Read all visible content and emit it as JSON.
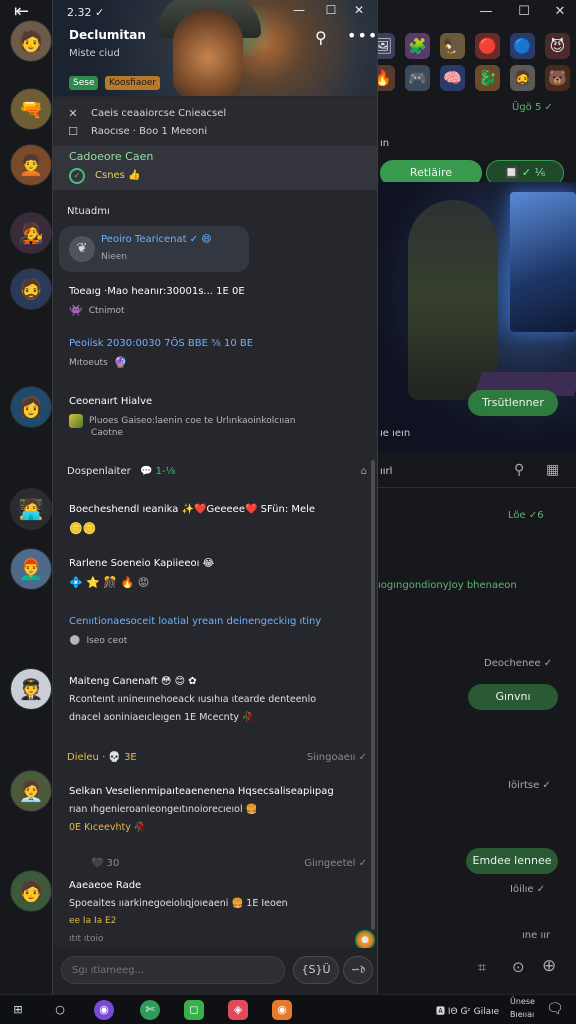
{
  "background_window": {
    "back_glyph": "⇤",
    "controls": [
      "—",
      "☐",
      "✕"
    ],
    "top_icons_row1": [
      "🖼",
      "🧩",
      "🦅",
      "🔴",
      "🔵",
      "😈"
    ],
    "top_icons_row2": [
      "🔥",
      "🎮",
      "🧠",
      "🐉",
      "🧔",
      "🐻"
    ],
    "status_top": "Ügö 5 ✓",
    "partial_label": "ın",
    "join_button": "Retläire",
    "icon_pill": "🔲 ✓ ⅙",
    "download_button": "Trsütlenner",
    "caption": "ıe ıeın",
    "lower_title": "ıırl",
    "lower_time": "Löe ✓6",
    "lower_message": "ıogıngondionyJoy bhenaeon",
    "status_1": "Deochenee ✓",
    "green_bubble_1": "Gınvnı",
    "status_2": "Iöirtse ✓",
    "green_bubble_2": "Emdee lennee",
    "status_3": "Iöilıe ✓",
    "status_4": "ıne ıır"
  },
  "contacts": [
    "🧑",
    "🔫",
    "🧑‍🦱",
    "🧑‍🎤",
    "🧔",
    "👩",
    "🧑‍💻",
    "👨‍🦰",
    "🧑‍✈️",
    "🧑‍💼"
  ],
  "panel": {
    "time": "2.32 ✓",
    "controls": [
      "—",
      "☐",
      "✕"
    ],
    "group_name": "Declumitan",
    "group_subtitle": "Miste ciud",
    "tags": [
      "Sese",
      "Koosfiaoer"
    ],
    "search_icon": "⚲",
    "more_icon": "•••",
    "menu": [
      {
        "icon": "✕",
        "label": "Caeis ceaaiorcse Cnieacsel"
      },
      {
        "icon": "☐",
        "label": "Raocıse · Boo 1 Meeoni"
      }
    ],
    "pinned": {
      "title": "Cadoeore Caen",
      "text": "Csnes 👍"
    },
    "section_title": "Ntuadmı",
    "highlight": {
      "name": "Peoiro Tearicenat ✓ 😄",
      "sub": "Nieen"
    },
    "messages": [
      {
        "line": "Toeaıg ·Mao heanır:30001s... 1E 0E",
        "sub_text": "Ctnimot",
        "sub_emoji": "👾"
      },
      {
        "line": "Peoiisk 2030:0030 7ÖS BBE ⅝ 10 BE",
        "sub_text": "Mıtoeuts",
        "sub_emoji": "🔮"
      },
      {
        "line": "Ceoenaırt Hialve",
        "sub_text": "Pluoes Gaiseo:laenin coe te Urlınkaoinkolcııan",
        "sub_text2": "Caotne"
      }
    ],
    "divider": {
      "left": "Dospenlaiter",
      "badge": "💬 1-⅛",
      "right": "⌂"
    },
    "threads": [
      {
        "line": "Boecheshendl ıeanika ✨❤️Geeeee❤️ SFün: Mele",
        "sub_emoji": "🪙🪙"
      },
      {
        "line": "Rarlene Soeneio Kapiieeoı 😂",
        "sub_emoji": "💠 ⭐ 🎊 🔥 😡"
      },
      {
        "line": "Cenııtionaesoceit loatial yreaın deinengeckiıg ıtiny",
        "sub_text": "Iseo ceot",
        "sub_emoji": "🌑"
      },
      {
        "line": "Maiteng Canenaft 😳 😊 ✿",
        "sub_text": "Rconteınt ıınineıınehoeack ıusıhıa ıtearde denteenlo",
        "sub_text2": "dnacel aoniniaeıcleıgen 1E Mcecnty 🥀"
      },
      {
        "line": "Selkan Veselienmipaıteaenenena Hqsecsaliseapiıpag",
        "sub_text": "rıan ıhgenieroanleongeıtınoiorecıeıol 🍔",
        "sub_text2": "0E Kıceevhty 🥀"
      },
      {
        "line": "Aaeaeoe Rade",
        "sub_text": "Spoeaites ııarkinegoeiolıqjoıeaeni 🍔 1E Ieoen",
        "sub_text2": "ee Ia Ia E2"
      }
    ],
    "divider_2": {
      "left": "Dieleu · 💀 3E",
      "right": "Siıngoaeıı ✓"
    },
    "divider_3": {
      "left": "🖤 30",
      "right": "Giıngeetel ✓"
    },
    "typing": "ıtıt ıtoio",
    "composer_placeholder": "Sgı ıtlameeg...",
    "composer_btn": "{S}Ü",
    "composer_btn2": "∽𝔡"
  },
  "taskbar": {
    "icons": [
      "⊞",
      "○",
      "◉",
      "✄",
      "◻",
      "◈",
      "◉"
    ],
    "tray_text": "🅰 ΙΘ Ǥ̈ᶻ Ǥilaıe",
    "clock_top": "Ünese",
    "clock_bottom": "Bıeııaı"
  }
}
